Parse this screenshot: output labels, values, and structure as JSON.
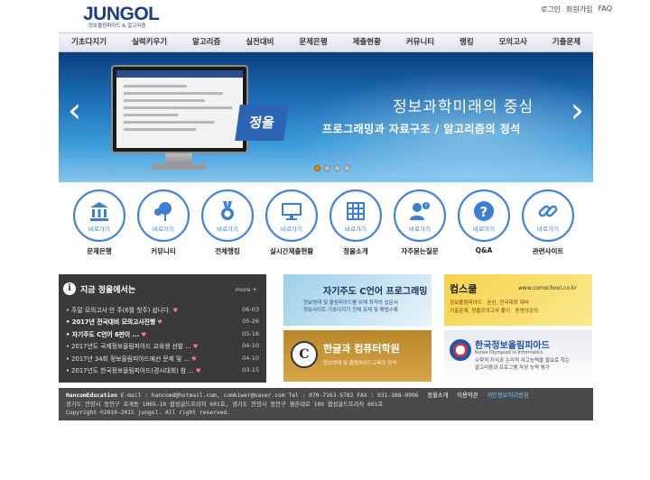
{
  "header": {
    "logo_text": "JUNGOL",
    "logo_sub": "정보올림피아드 & 알고리즘",
    "links": [
      "로그인",
      "회원가입",
      "FAQ"
    ]
  },
  "nav": {
    "items": [
      "기초다지기",
      "실력키우기",
      "알고리즘",
      "실전대비",
      "문제은행",
      "제출현황",
      "커뮤니티",
      "랭킹",
      "모의고사",
      "기출문제"
    ]
  },
  "banner": {
    "badge": "정올",
    "headline": "정보과학미래의 중심",
    "sub": "프로그래밍과 자료구조 / 알고리즘의 정석",
    "prev_arrow": "‹",
    "next_arrow": "›",
    "active_dot": 0
  },
  "quick": {
    "caption": "바로가기",
    "items": [
      {
        "label": "문제은행",
        "icon": "bank-icon"
      },
      {
        "label": "커뮤니티",
        "icon": "community-icon"
      },
      {
        "label": "전체랭킹",
        "icon": "medal-icon"
      },
      {
        "label": "실시간제출현황",
        "icon": "monitor-icon"
      },
      {
        "label": "정올소개",
        "icon": "grid-icon"
      },
      {
        "label": "자주묻는질문",
        "icon": "question-person-icon"
      },
      {
        "label": "Q&A",
        "icon": "question-icon"
      },
      {
        "label": "관련사이트",
        "icon": "link-icon"
      }
    ]
  },
  "notice": {
    "info_glyph": "i",
    "title": "지금 정올에서는",
    "more": "more +",
    "items": [
      {
        "text": "• 주말 모의고사 안 주(6월 첫주) 쉽니다.",
        "date": "06-03",
        "hot": false
      },
      {
        "text": "• 2017년 전국대비 모의고사진행",
        "date": "05-26",
        "hot": true
      },
      {
        "text": "• 자기주도 C언어 6판이 ...",
        "date": "05-16",
        "hot": true
      },
      {
        "text": "• 2017년도 국제정보올림피아드 교육생 선발 ...",
        "date": "04-10",
        "hot": false
      },
      {
        "text": "• 2017년 34회 정보올림피아드예선 문제 및 ...",
        "date": "04-10",
        "hot": false
      },
      {
        "text": "• 2017년도 한국정보올림피아드(경시대회) 참 ...",
        "date": "03-15",
        "hot": false
      }
    ]
  },
  "ads": {
    "ad1": {
      "title": "자기주도 C언어 프로그래밍",
      "sub1": "정보영재 및 올림피아드를 위해 최적의 입문서",
      "sub2": "정보사이트 기초다지기 전체 문제 및 해법수록"
    },
    "ad2": {
      "title": "컴스쿨",
      "url": "www.comschool.co.kr",
      "tag1": "정보올림피아드",
      "tag2": "본선, 전국대회 대비",
      "tag3": "기출문제, 정올모의고사 풀이",
      "tag4": "동영상강의"
    },
    "ad3": {
      "logo": "C",
      "title": "한글과 컴퓨터학원",
      "sub": "정보영재 및 올림피아드교육의 정석"
    },
    "ad4": {
      "title": "한국정보올림피아드",
      "en": "Korea Olympiad in Informatics",
      "sub1": "수학적 지식과 논리적 사고능력을 필요로 하는",
      "sub2": "알고리즘과 프로그램 작성 능력 평가"
    }
  },
  "footer": {
    "brand": "HancomEducation",
    "line1": "E-mail : hancomd@hotmail.com, comkiwer@naver.com Tel : 070-7163-5782 FAX : 031-388-0996",
    "link_about": "정올소개",
    "link_terms": "이용약관",
    "link_privacy": "개인정보처리방침",
    "line2": "경기도 안양시 동안구 호계동 1065-10 협성골드프라자 601호, 경기도 안양시 동안구 평촌대로 109 협성골드프라자 601호",
    "line3": "Copyright ©2010-2015 jungol. All right reserved."
  }
}
